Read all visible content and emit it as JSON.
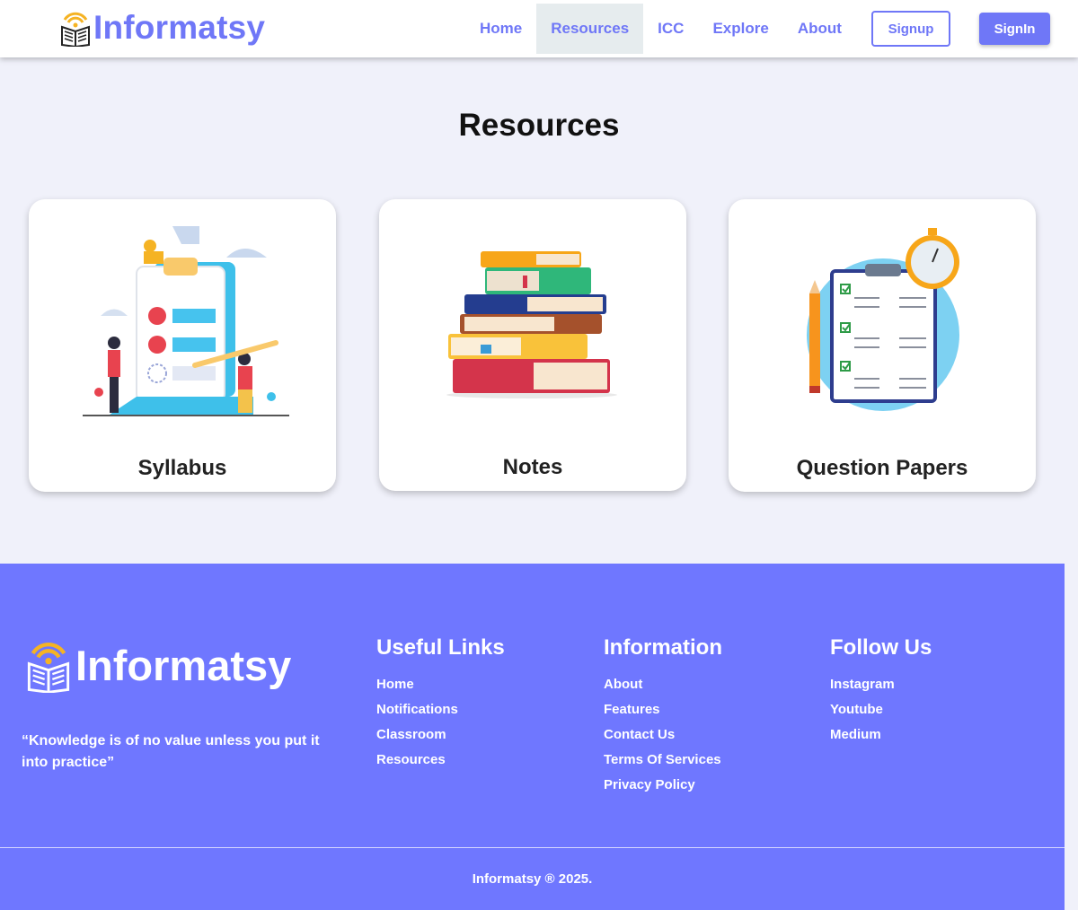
{
  "header": {
    "brand": "Informatsy",
    "nav": [
      {
        "label": "Home"
      },
      {
        "label": "Resources",
        "active": true
      },
      {
        "label": "ICC"
      },
      {
        "label": "Explore"
      },
      {
        "label": "About"
      }
    ],
    "signup_label": "Signup",
    "signin_label": "SignIn"
  },
  "main": {
    "title": "Resources",
    "cards": [
      {
        "title": "Syllabus",
        "icon": "syllabus-illustration"
      },
      {
        "title": "Notes",
        "icon": "books-stack-illustration"
      },
      {
        "title": "Question Papers",
        "icon": "checklist-clipboard-illustration"
      }
    ]
  },
  "footer": {
    "brand": "Informatsy",
    "quote": "“Knowledge is of no value unless you put it into practice”",
    "useful_links": {
      "heading": "Useful Links",
      "items": [
        "Home",
        "Notifications",
        "Classroom",
        "Resources"
      ]
    },
    "information": {
      "heading": "Information",
      "items": [
        "About",
        "Features",
        "Contact Us",
        "Terms Of Services",
        "Privacy Policy"
      ]
    },
    "follow_us": {
      "heading": "Follow Us",
      "items": [
        "Instagram",
        "Youtube",
        "Medium"
      ]
    },
    "copyright": "Informatsy ® 2025."
  },
  "colors": {
    "brand": "#6f77f7",
    "footer_bg": "#6f77ff",
    "page_bg": "#f0f1fa",
    "logo_accent": "#f5b324"
  }
}
